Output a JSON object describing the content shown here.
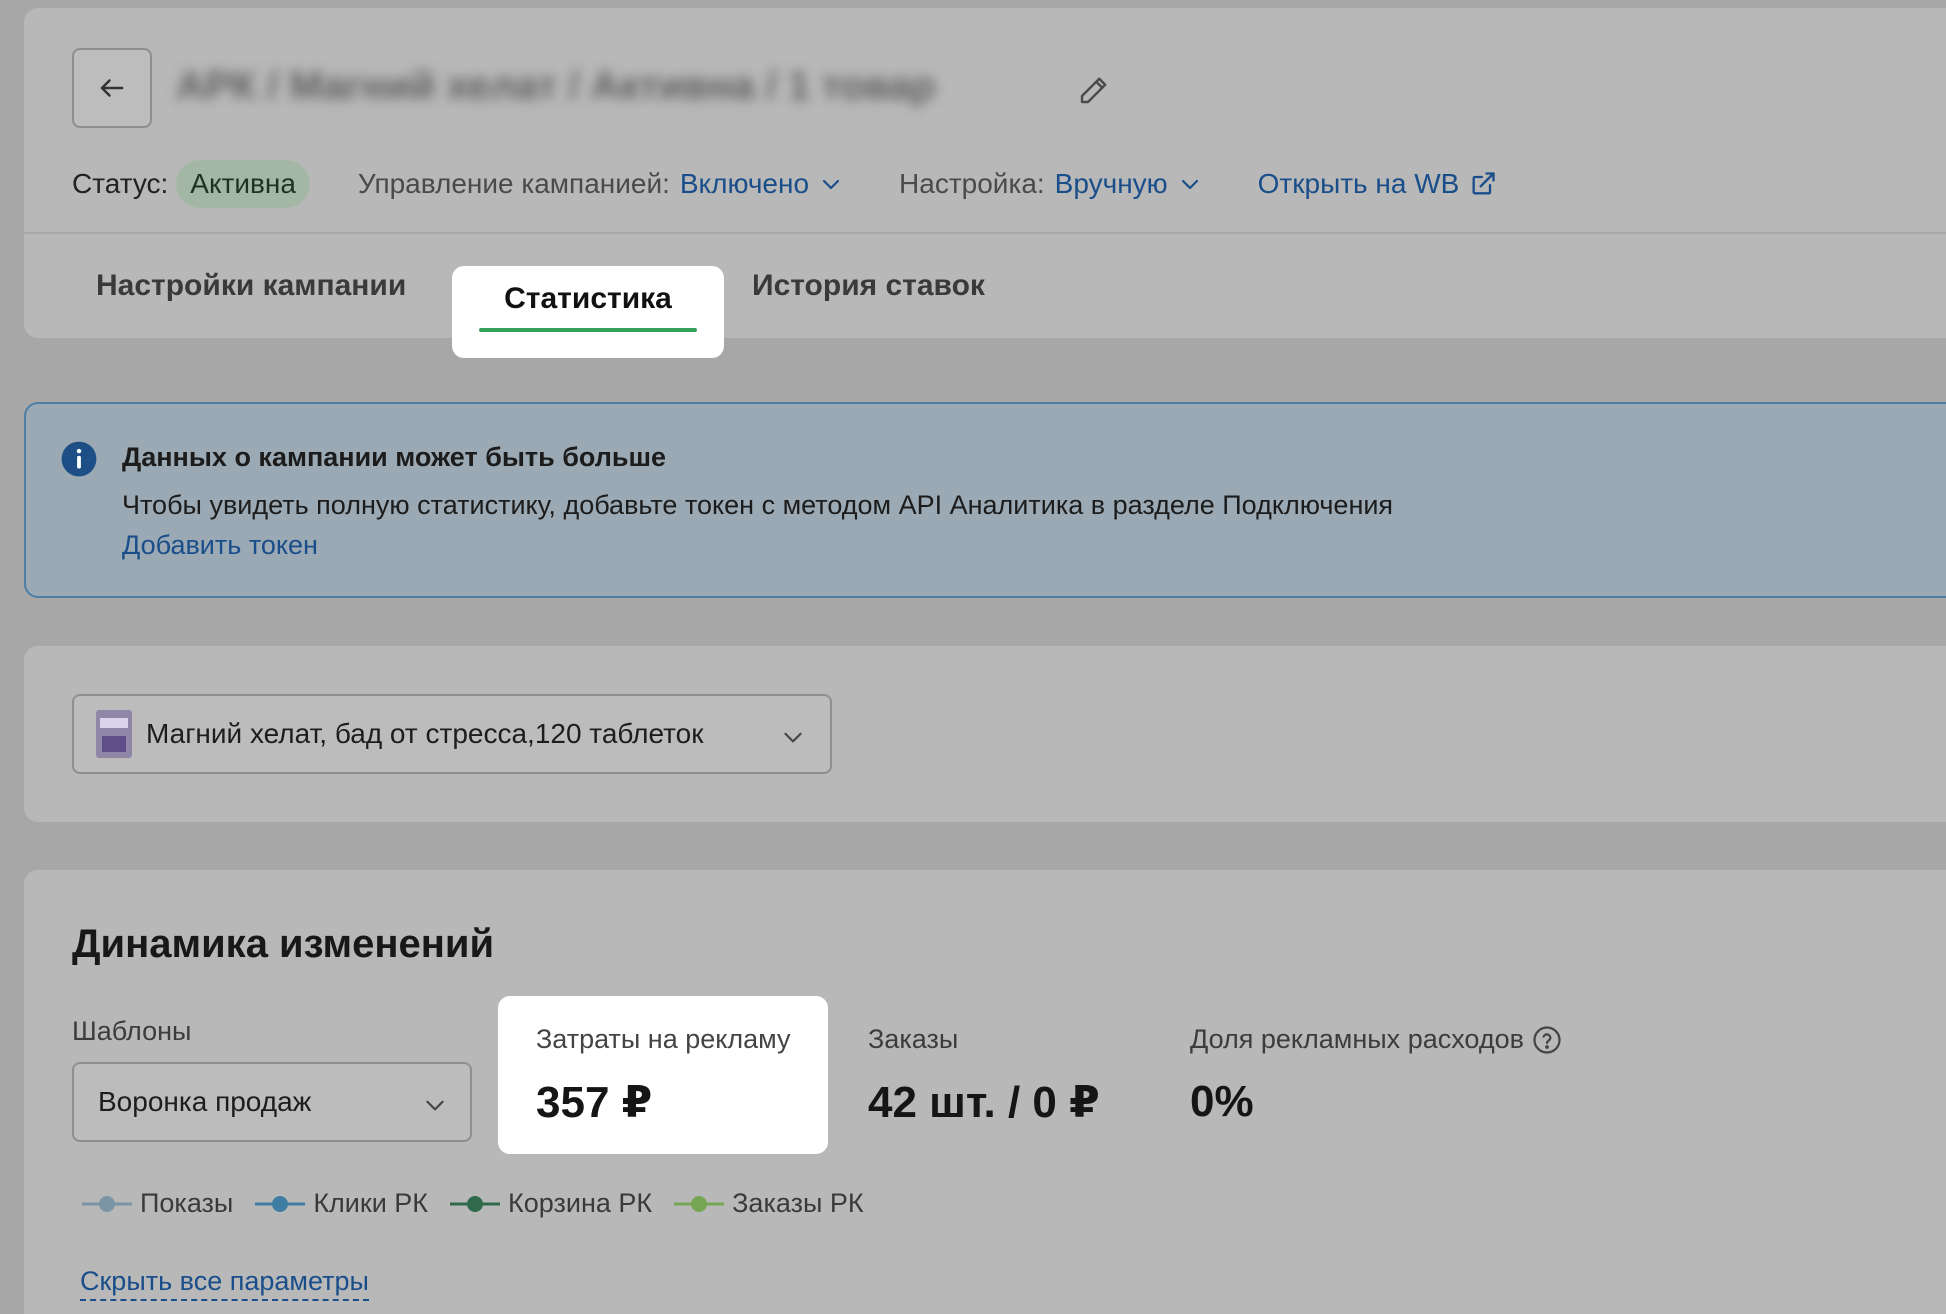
{
  "header": {
    "campaign_title": "АРК / Магний хелат / Активна / 1 товар",
    "status_label": "Статус:",
    "status_value": "Активна",
    "management_label": "Управление кампанией:",
    "management_value": "Включено",
    "setting_label": "Настройка:",
    "setting_value": "Вручную",
    "open_wb_label": "Открыть на WB",
    "icons": [
      "arrow-left-icon",
      "pencil-icon",
      "chevron-down-icon",
      "external-link-icon"
    ]
  },
  "tabs": [
    {
      "label": "Настройки кампании",
      "active": false
    },
    {
      "label": "Статистика",
      "active": true
    },
    {
      "label": "История ставок",
      "active": false
    }
  ],
  "info": {
    "title": "Данных о кампании может быть больше",
    "text": "Чтобы увидеть полную статистику, добавьте токен с методом API Аналитика в разделе Подключения",
    "link": "Добавить токен"
  },
  "product": {
    "selected": "Магний хелат, бад от стресса,120 таблеток"
  },
  "dynamics": {
    "title": "Динамика изменений",
    "templates_label": "Шаблоны",
    "template_selected": "Воронка продаж",
    "metrics": [
      {
        "label": "Затраты на рекламу",
        "value": "357 ₽"
      },
      {
        "label": "Заказы",
        "value": "42 шт. / 0 ₽"
      },
      {
        "label": "Доля рекламных расходов",
        "value": "0%"
      }
    ],
    "legend": [
      {
        "label": "Показы",
        "color": "#7b95a6"
      },
      {
        "label": "Клики РК",
        "color": "#3f7ea3"
      },
      {
        "label": "Корзина РК",
        "color": "#2f6b4a"
      },
      {
        "label": "Заказы РК",
        "color": "#74a654"
      }
    ],
    "hide_link": "Скрыть все параметры"
  },
  "colors": {
    "accent_link": "#1a4e8a",
    "active_tab_underline": "#35a05a",
    "status_badge": "#a4b7a5",
    "info_border": "#4d7ea6"
  }
}
